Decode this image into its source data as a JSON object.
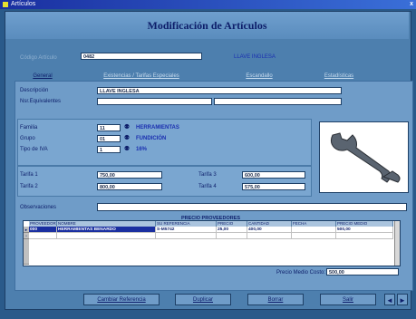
{
  "window": {
    "title": "Artículos",
    "close": "x"
  },
  "header": {
    "title": "Modificación de Artículos"
  },
  "top": {
    "code_label": "Código Artículo",
    "code_value": "0482",
    "desc_value": "LLAVE INGLESA"
  },
  "tabs": [
    {
      "label": "General"
    },
    {
      "label": "Existencias / Tarifas Especiales"
    },
    {
      "label": "Escandallo"
    },
    {
      "label": "Estadísticas"
    }
  ],
  "general": {
    "descripcion_label": "Descripción",
    "descripcion_value": "LLAVE INGLESA",
    "nsec_label": "Nsr.Equivalentes",
    "familia_label": "Familia",
    "familia_code": "11",
    "familia_name": "HERRAMIENTAS",
    "grupo_label": "Grupo",
    "grupo_code": "01",
    "grupo_name": "FUNDICIÓN",
    "iva_label": "Tipo de IVA",
    "iva_code": "1",
    "iva_name": "16%",
    "tarifa1_label": "Tarifa 1",
    "tarifa1_value": "750,00",
    "tarifa2_label": "Tarifa 2",
    "tarifa2_value": "800,00",
    "tarifa3_label": "Tarifa 3",
    "tarifa3_value": "600,00",
    "tarifa4_label": "Tarifa 4",
    "tarifa4_value": "575,00",
    "obs_label": "Observaciones"
  },
  "grid": {
    "title": "PRECIO PROVEEDORES",
    "columns": [
      "PROVEEDOR",
      "NOMBRE",
      "SU REFERENCIA",
      "PRECIO",
      "CANTIDAD",
      "FECHA",
      "PRECIO MEDIO"
    ],
    "rows": [
      [
        "000",
        "HERRAMIENTAS BENARDO",
        "S-M5742",
        "25,00",
        "400,00",
        "",
        "500,00"
      ],
      [
        "",
        "",
        "",
        "",
        "",
        "",
        ""
      ]
    ]
  },
  "precio_medio": {
    "label": "Precio Medio Costo:",
    "value": "500,00"
  },
  "buttons": {
    "cambiar": "Cambiar Referencia",
    "duplicar": "Duplicar",
    "borrar": "Borrar",
    "salir": "Salir",
    "prev": "◄",
    "next": "►"
  }
}
